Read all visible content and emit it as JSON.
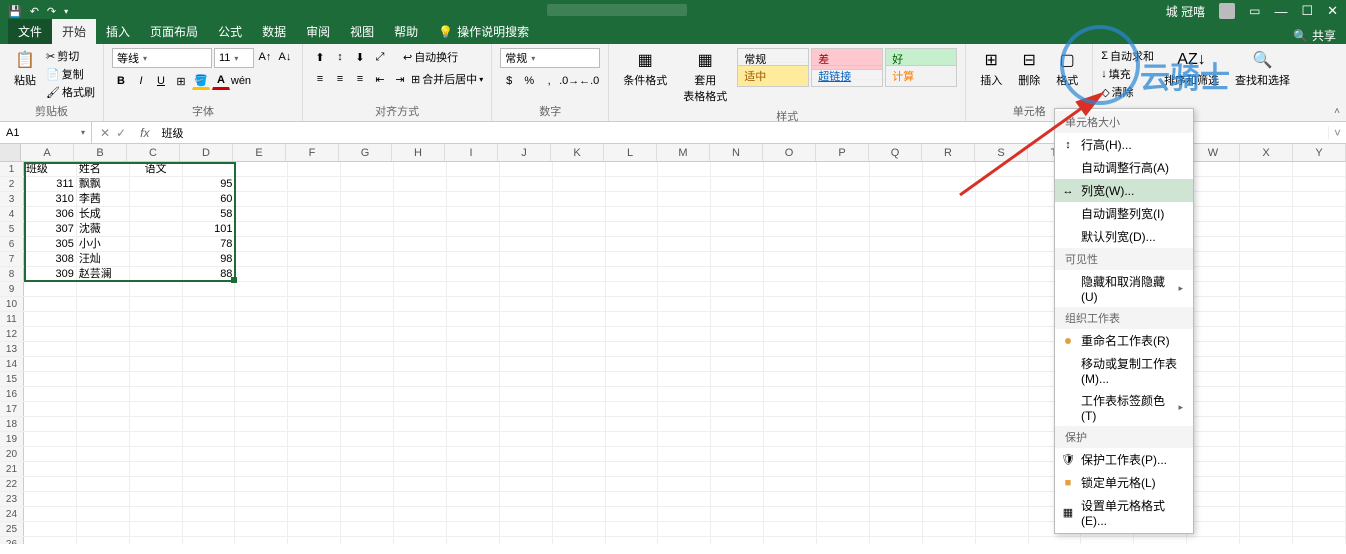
{
  "titlebar": {
    "username": "城 冠嘻",
    "autosave_off": ""
  },
  "ribbon": {
    "tabs": {
      "file": "文件",
      "home": "开始",
      "insert": "插入",
      "layout": "页面布局",
      "formulas": "公式",
      "data": "数据",
      "review": "审阅",
      "view": "视图",
      "help": "帮助"
    },
    "search_prompt": "操作说明搜索",
    "share": "共享",
    "clipboard": {
      "paste": "粘贴",
      "cut": "剪切",
      "copy": "复制",
      "brush": "格式刷",
      "group": "剪贴板"
    },
    "font": {
      "family": "等线",
      "size": "11",
      "group": "字体"
    },
    "alignment": {
      "wrap": "自动换行",
      "merge": "合并后居中",
      "group": "对齐方式"
    },
    "number": {
      "format": "常规",
      "group": "数字"
    },
    "styles": {
      "cond": "条件格式",
      "table": "套用\n表格格式",
      "normal": "常规",
      "bad": "差",
      "good": "好",
      "neutral": "适中",
      "hyperlink": "超链接",
      "calc": "计算",
      "group": "样式"
    },
    "cells": {
      "insert": "插入",
      "delete": "删除",
      "format": "格式",
      "group": "单元格"
    },
    "editing": {
      "sum": "自动求和",
      "fill": "填充",
      "clear": "清除",
      "sort": "排序和筛选",
      "find": "查找和选择"
    }
  },
  "fbar": {
    "name": "A1",
    "fx": "fx",
    "value": "班级"
  },
  "columns": [
    "A",
    "B",
    "C",
    "D",
    "E",
    "F",
    "G",
    "H",
    "I",
    "J",
    "K",
    "L",
    "M",
    "N",
    "O",
    "P",
    "Q",
    "R",
    "S",
    "T",
    "U",
    "V",
    "W",
    "X",
    "Y"
  ],
  "rows_visible": 26,
  "table": {
    "headers": [
      "班级",
      "姓名",
      "语文"
    ],
    "rows": [
      [
        "311",
        "飘飘",
        "95"
      ],
      [
        "310",
        "李茜",
        "60"
      ],
      [
        "306",
        "长成",
        "58"
      ],
      [
        "307",
        "沈薇",
        "101"
      ],
      [
        "305",
        "小小",
        "78"
      ],
      [
        "308",
        "汪灿",
        "98"
      ],
      [
        "309",
        "赵芸澜",
        "88"
      ]
    ]
  },
  "format_menu": {
    "s1": "单元格大小",
    "row_height": "行高(H)...",
    "auto_row": "自动调整行高(A)",
    "col_width": "列宽(W)...",
    "auto_col": "自动调整列宽(I)",
    "default_col": "默认列宽(D)...",
    "s2": "可见性",
    "hide": "隐藏和取消隐藏(U)",
    "s3": "组织工作表",
    "rename": "重命名工作表(R)",
    "move": "移动或复制工作表(M)...",
    "tabcolor": "工作表标签颜色(T)",
    "s4": "保护",
    "protect": "保护工作表(P)...",
    "lock": "锁定单元格(L)",
    "fmtcells": "设置单元格格式(E)..."
  },
  "watermark": "云骑士"
}
